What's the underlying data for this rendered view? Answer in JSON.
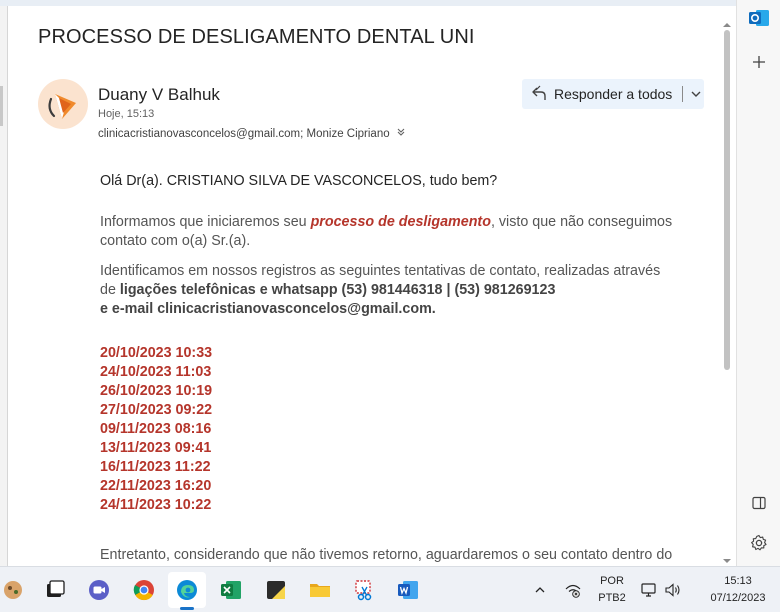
{
  "email": {
    "subject": "PROCESSO DE DESLIGAMENTO DENTAL UNI",
    "sender": "Duany V Balhuk",
    "date": "Hoje, 15:13",
    "recipients": "clinicacristianovasconcelos@gmail.com; Monize Cipriano",
    "reply_all_label": "Responder a todos",
    "body": {
      "greeting": "Olá Dr(a). CRISTIANO SILVA DE VASCONCELOS, tudo bem?",
      "p1_before": "Informamos que iniciaremos seu ",
      "p1_highlight": "processo de desligamento",
      "p1_after": ", visto que não conseguimos contato com o(a) Sr.(a).",
      "p2_line1": "Identificamos em nossos registros as seguintes tentativas de contato, realizadas através",
      "p2_de": "de ",
      "p2_bold1": "ligações telefônicas e whatsapp (53) 981446318 | (53) 981269123",
      "p2_bold2": "e e-mail clinicacristianovasconcelos@gmail.com.",
      "dates": [
        "20/10/2023 10:33",
        "24/10/2023 11:03",
        "26/10/2023 10:19",
        "27/10/2023 09:22",
        "09/11/2023 08:16",
        "13/11/2023 09:41",
        "16/11/2023 11:22",
        "22/11/2023 16:20",
        "24/11/2023 10:22"
      ],
      "p3": "Entretanto, considerando que não tivemos retorno, aguardaremos o seu contato dentro do"
    }
  },
  "taskbar": {
    "lang_top": "POR",
    "lang_bottom": "PTB2",
    "time": "15:13",
    "date": "07/12/2023"
  },
  "colors": {
    "accent": "#0f6cbd",
    "red_text": "#b5352b",
    "reply_bg": "#ebf3fc"
  }
}
